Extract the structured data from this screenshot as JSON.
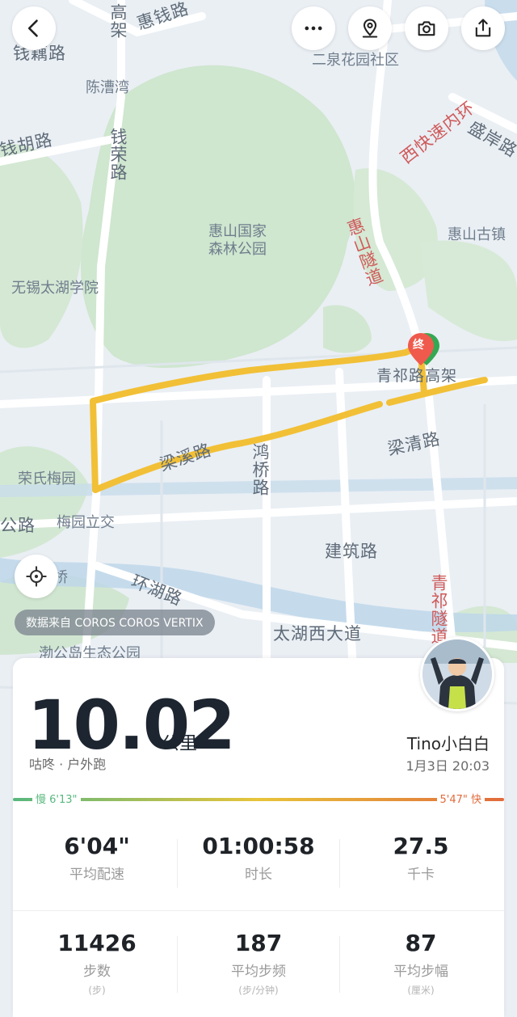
{
  "map": {
    "labels": {
      "gaojia_vertical": "高架",
      "huiqian_road": "惠钱路",
      "qiancheng_road": "钱藕路",
      "chencaowan": "陈漕湾",
      "erquan": "二泉花园社区",
      "xikuai": "西快速内环",
      "shengan": "盛岸路",
      "qianhu": "钱胡路",
      "qianrong": "钱荣路",
      "huishan_park": "惠山国家\n森林公园",
      "huishan_tunnel": "惠山隧道",
      "huishan_town": "惠山古镇",
      "taihu_college": "无锡太湖学院",
      "qingqi_elevated": "青祁路高架",
      "liangxi": "梁溪路",
      "hongqiao": "鸿桥路",
      "liangqing": "梁清路",
      "rongshi": "荣氏梅园",
      "gong_road": "公路",
      "meiyuan": "梅园立交",
      "jianzhu": "建筑路",
      "qiao": "桥",
      "huanhu": "环湖路",
      "qingqi_tunnel": "青祁隧道",
      "taihu_west": "太湖西大道",
      "bogong": "渤公岛生态公园"
    },
    "end_marker": "终",
    "data_source": "数据来自 COROS COROS VERTIX"
  },
  "buttons": {
    "back": "back",
    "more": "more",
    "location_pin": "location",
    "camera": "camera",
    "share": "share",
    "locate": "locate"
  },
  "summary": {
    "distance": "10.02",
    "distance_unit": "公里",
    "activity_type": "咕咚 · 户外跑",
    "user_name": "Tino小白白",
    "date_time": "1月3日 20:03",
    "pace_slow": "慢 6'13\"",
    "pace_fast": "5'47\" 快"
  },
  "stats": [
    {
      "value": "6'04\"",
      "label": "平均配速",
      "sub": ""
    },
    {
      "value": "01:00:58",
      "label": "时长",
      "sub": ""
    },
    {
      "value": "27.5",
      "label": "千卡",
      "sub": ""
    },
    {
      "value": "11426",
      "label": "步数",
      "sub": "(步)"
    },
    {
      "value": "187",
      "label": "平均步频",
      "sub": "(步/分钟)"
    },
    {
      "value": "87",
      "label": "平均步幅",
      "sub": "(厘米)"
    }
  ],
  "colors": {
    "route": "#f2c036",
    "pace_slow": "#58b87e",
    "pace_fast": "#e26b3c",
    "green_area": "#cfe6cf",
    "water": "#bcd6ea"
  }
}
